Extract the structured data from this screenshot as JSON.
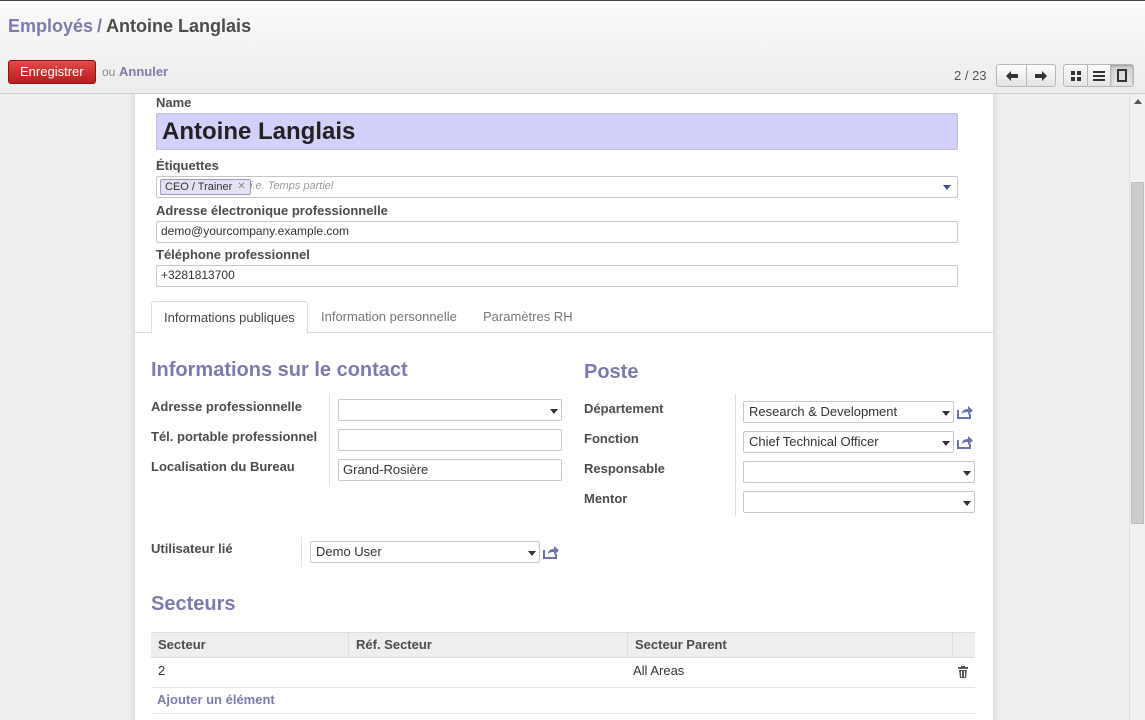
{
  "breadcrumb": {
    "parent": "Employés",
    "separator": "/",
    "current": "Antoine Langlais"
  },
  "toolbar": {
    "save_label": "Enregistrer",
    "or_text": "ou",
    "cancel_label": "Annuler"
  },
  "pager": {
    "value": "2 / 23",
    "prev_icon": "arrow-left-icon",
    "next_icon": "arrow-right-icon"
  },
  "views": {
    "kanban_icon": "kanban-view-icon",
    "list_icon": "list-view-icon",
    "form_icon": "form-view-icon",
    "active": "form"
  },
  "form": {
    "name_label": "Name",
    "name_value": "Antoine Langlais",
    "tags_label": "Étiquettes",
    "tags": [
      "CEO / Trainer"
    ],
    "tags_placeholder": "i.e. Temps partiel",
    "email_label": "Adresse électronique professionnelle",
    "email_value": "demo@yourcompany.example.com",
    "phone_label": "Téléphone professionnel",
    "phone_value": "+3281813700"
  },
  "tabs": [
    {
      "label": "Informations publiques",
      "active": true
    },
    {
      "label": "Information personnelle",
      "active": false
    },
    {
      "label": "Paramètres RH",
      "active": false
    }
  ],
  "contact": {
    "title": "Informations sur le contact",
    "address_label": "Adresse professionnelle",
    "address_value": "",
    "mobile_label": "Tél. portable professionnel",
    "mobile_value": "",
    "office_label": "Localisation du Bureau",
    "office_value": "Grand-Rosière"
  },
  "position": {
    "title": "Poste",
    "department_label": "Département",
    "department_value": "Research & Development",
    "job_label": "Fonction",
    "job_value": "Chief Technical Officer",
    "manager_label": "Responsable",
    "manager_value": "",
    "coach_label": "Mentor",
    "coach_value": ""
  },
  "user": {
    "label": "Utilisateur lié",
    "value": "Demo User"
  },
  "sectors": {
    "title": "Secteurs",
    "columns": [
      "Secteur",
      "Réf. Secteur",
      "Secteur Parent"
    ],
    "rows": [
      {
        "sector": "2",
        "ref": "",
        "parent": "All Areas"
      }
    ],
    "add_label": "Ajouter un élément"
  },
  "colors": {
    "accent": "#7c7bad",
    "save": "#c9302c",
    "name_bg": "#d3d0fb"
  }
}
